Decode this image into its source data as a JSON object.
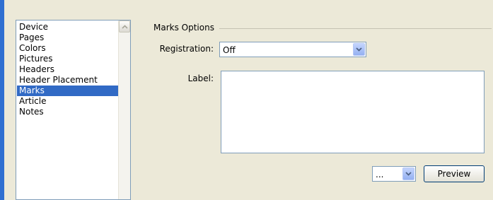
{
  "sidebar": {
    "items": [
      {
        "label": "Device"
      },
      {
        "label": "Pages"
      },
      {
        "label": "Colors"
      },
      {
        "label": "Pictures"
      },
      {
        "label": "Headers"
      },
      {
        "label": "Header Placement"
      },
      {
        "label": "Marks"
      },
      {
        "label": "Article"
      },
      {
        "label": "Notes"
      }
    ],
    "selected": "Marks"
  },
  "marks_options": {
    "group_title": "Marks Options",
    "registration_label": "Registration:",
    "registration_value": "Off",
    "label_label": "Label:",
    "label_value": ""
  },
  "footer": {
    "preset_value": "...",
    "preview_label": "Preview"
  },
  "colors": {
    "selection": "#316ac5",
    "accent": "#2f6fd1",
    "background": "#ece9d8"
  },
  "icons": [
    "scroll-up-icon",
    "dropdown-arrow-icon"
  ]
}
